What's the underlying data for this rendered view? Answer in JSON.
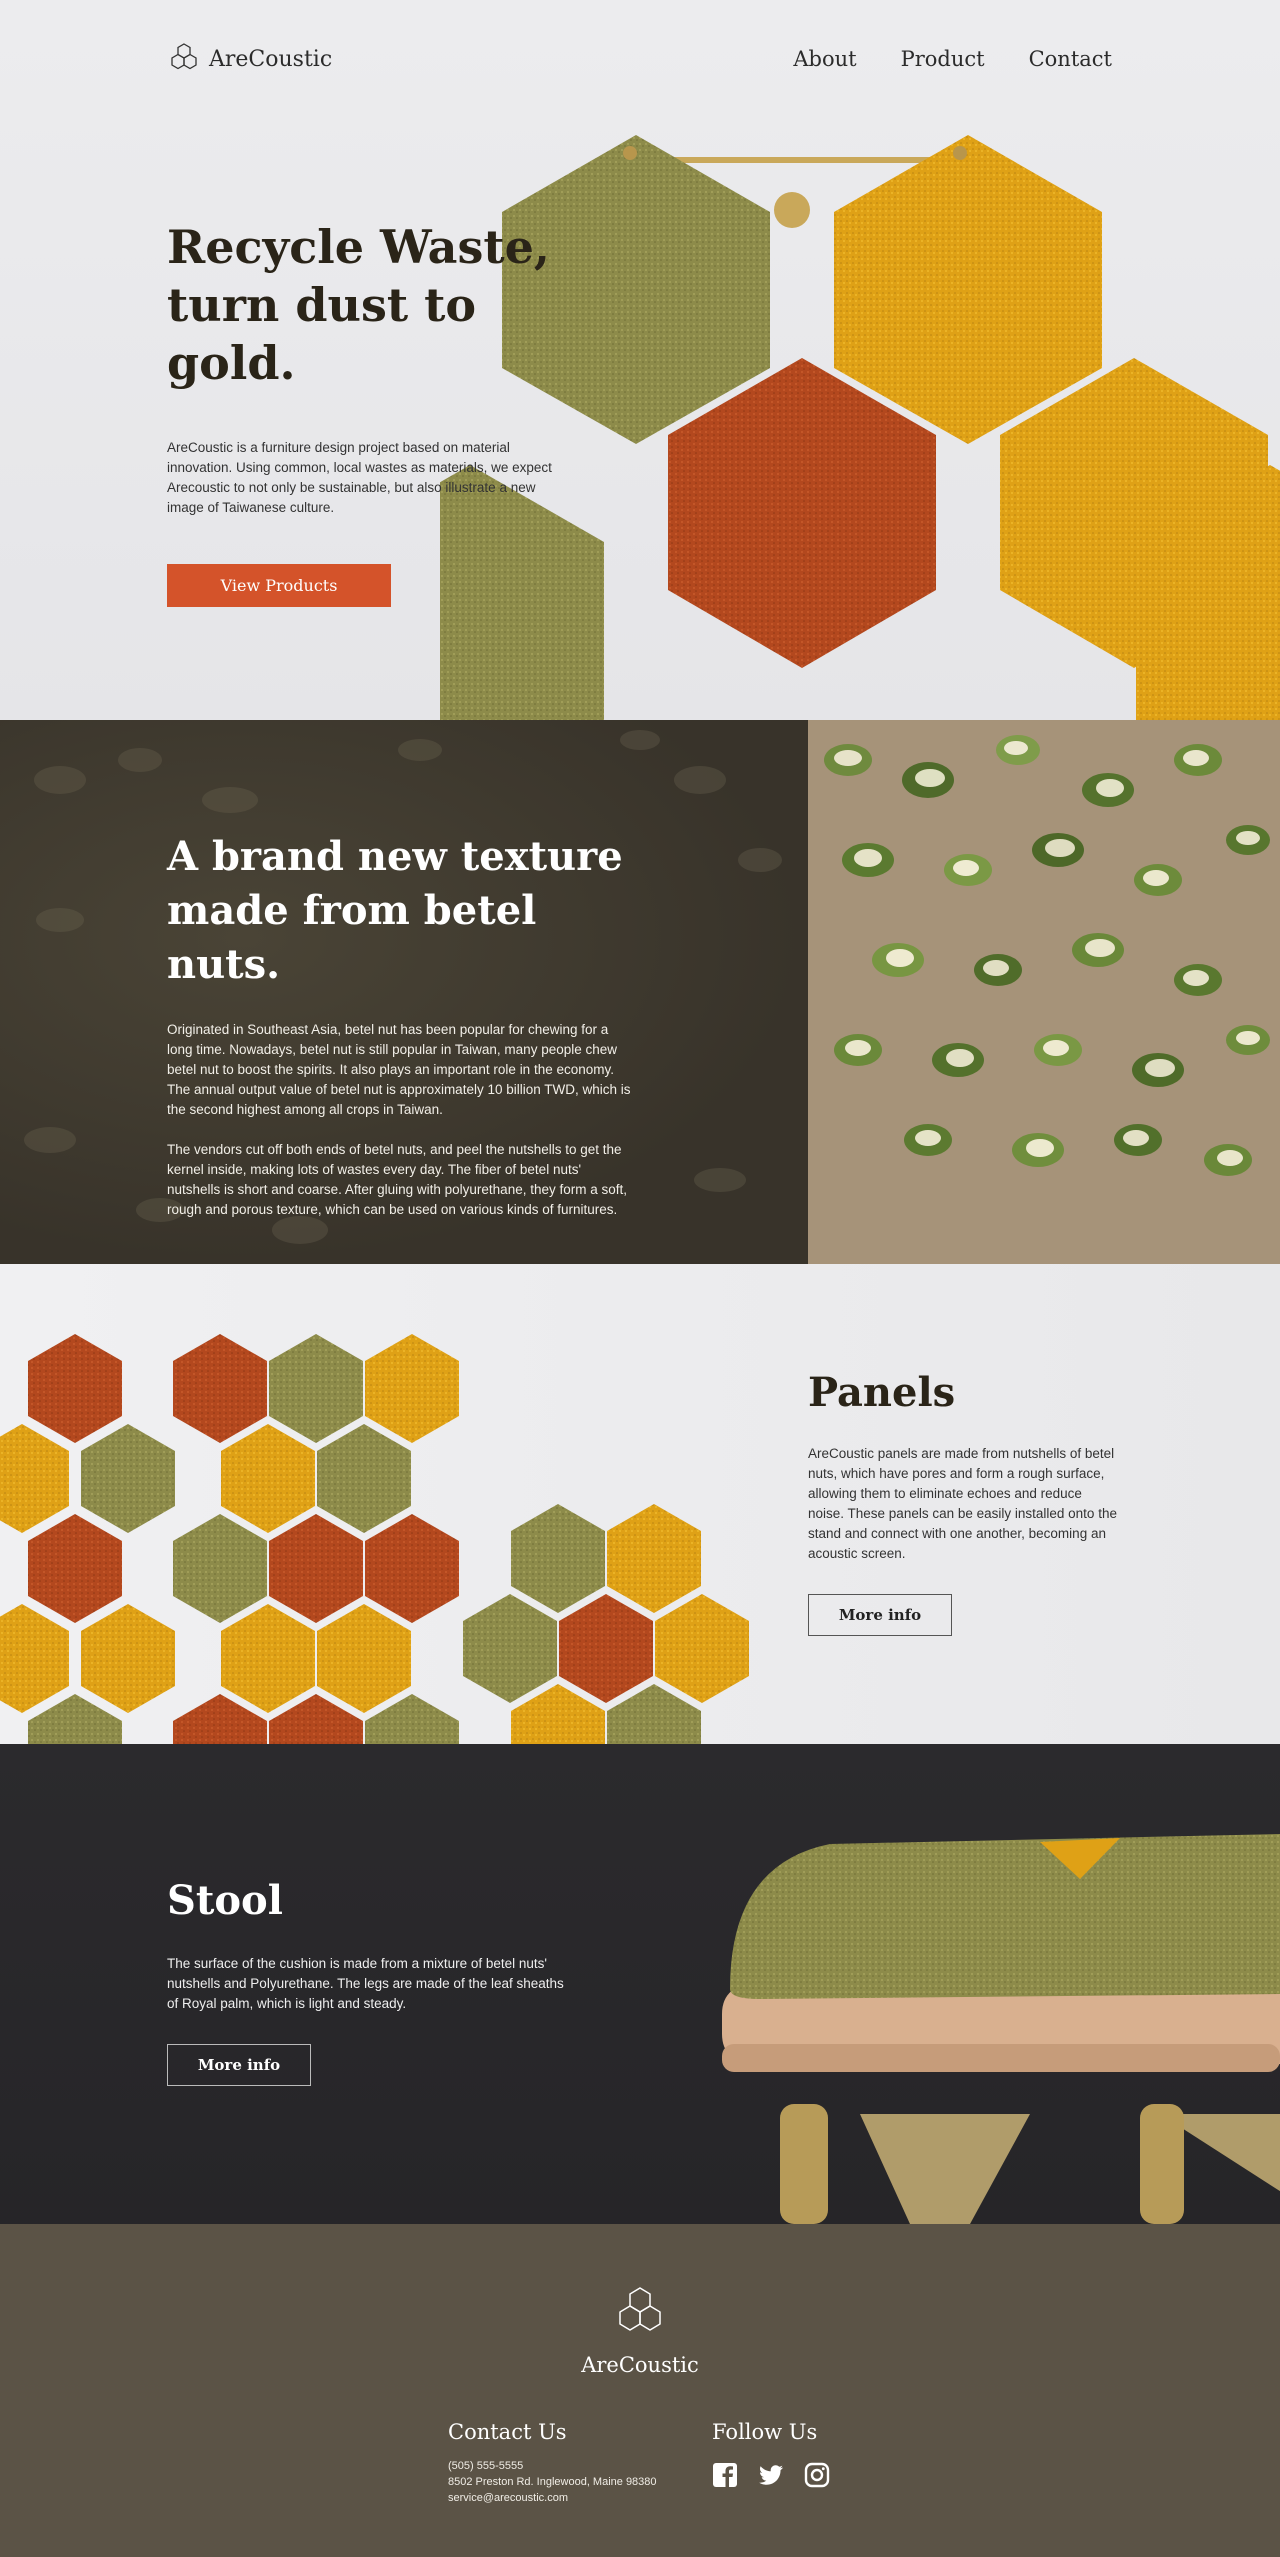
{
  "brand": {
    "name": "AreCoustic"
  },
  "nav": {
    "items": [
      {
        "label": "About"
      },
      {
        "label": "Product"
      },
      {
        "label": "Contact"
      }
    ]
  },
  "hero": {
    "title_line1": "Recycle Waste,",
    "title_line2": "turn dust to gold.",
    "description": "AreCoustic is a furniture design project based on material innovation. Using common, local wastes as materials, we expect Arecoustic to not only be sustainable, but also illustrate a new image of Taiwanese culture.",
    "cta_label": "View Products"
  },
  "betel": {
    "title_line1": "A brand new texture",
    "title_line2": "made from betel nuts.",
    "paragraph1": "Originated in Southeast Asia, betel nut has been popular for chewing for a long time. Nowadays, betel nut is still popular in Taiwan, many people chew betel nut to boost the spirits. It also plays an important role in the economy. The annual output value of betel nut is approximately 10 billion TWD, which is the second highest among all crops in Taiwan.",
    "paragraph2": "The vendors cut off both ends of betel nuts, and peel the nutshells to get the kernel inside, making lots of wastes every day. The fiber of betel nuts' nutshells is short and coarse. After gluing with polyurethane, they form a soft, rough and porous texture, which can be used on various kinds of furnitures."
  },
  "panels": {
    "title": "Panels",
    "description": "AreCoustic panels are made from nutshells of betel nuts, which have pores and form a rough surface, allowing them to eliminate echoes and reduce noise. These panels can be easily installed onto the stand and connect with one another, becoming an acoustic screen.",
    "button_label": "More info"
  },
  "stool": {
    "title": "Stool",
    "description": "The surface of the cushion is made from a mixture of betel nuts' nutshells and Polyurethane. The legs are made of the leaf sheaths of Royal palm, which is light and steady.",
    "button_label": "More info"
  },
  "footer": {
    "brand": "AreCoustic",
    "contact_heading": "Contact Us",
    "phone": "(505) 555-5555",
    "address": "8502 Preston Rd. Inglewood, Maine 98380",
    "email": "service@arecoustic.com",
    "follow_heading": "Follow Us",
    "social": [
      "facebook-icon",
      "twitter-icon",
      "instagram-icon"
    ]
  },
  "colors": {
    "accent": "#d4532a",
    "olive": "#8a8a45",
    "mustard": "#e0a316",
    "rust": "#b4471c",
    "footer_bg": "#5b5346",
    "stool_bg": "#2b2a2d",
    "betel_bg": "#3f3a2e"
  }
}
